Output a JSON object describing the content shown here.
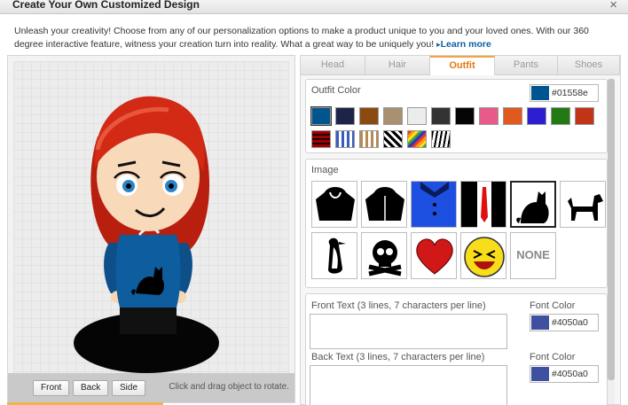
{
  "dialog": {
    "title": "Create Your Own Customized Design",
    "close_icon": "×"
  },
  "intro": {
    "text": "Unleash your creativity! Choose from any of our personalization options to make a product unique to you and your loved ones. With our 360 degree interactive feature, witness your creation turn into reality. What a great way to be uniquely you!",
    "learn_more": "Learn more",
    "arrow": "▸"
  },
  "preview": {
    "buttons": {
      "front": "Front",
      "back": "Back",
      "side": "Side"
    },
    "hint": "Click and drag object to rotate."
  },
  "tabs": [
    {
      "label": "Head"
    },
    {
      "label": "Hair"
    },
    {
      "label": "Outfit",
      "active": true
    },
    {
      "label": "Pants"
    },
    {
      "label": "Shoes"
    }
  ],
  "outfit_color": {
    "label": "Outfit Color",
    "value": "#01558e",
    "swatches": [
      "#01558e",
      "#1d2447",
      "#8a4a12",
      "#a89070",
      "#ececec",
      "#333333",
      "#050505",
      "#e85a8a",
      "#e05a1e",
      "#2b1fcf",
      "#247a12",
      "#c23418"
    ],
    "patterns": [
      "red-plaid",
      "blue-plaid",
      "tan-plaid",
      "houndstooth",
      "rainbow-stripe",
      "zebra"
    ]
  },
  "image": {
    "label": "Image",
    "items": [
      "hoodie-icon",
      "zip-hoodie-icon",
      "shirt-collar-icon",
      "suit-tie-icon",
      "cat-icon",
      "dog-icon",
      "penguin-icon",
      "skull-icon",
      "heart-icon",
      "laughing-face-icon"
    ],
    "none_label": "NONE",
    "selected": "cat-icon"
  },
  "front_text": {
    "label": "Front Text (3 lines, 7 characters per line)",
    "value": "",
    "font_color_label": "Font Color",
    "font_color": "#4050a0"
  },
  "back_text": {
    "label": "Back Text (3 lines, 7 characters per line)",
    "value": "",
    "font_color_label": "Font Color",
    "font_color": "#4050a0"
  },
  "colors": {
    "accent": "#e47911",
    "link": "#0b5fa5",
    "shirt": "#01558e",
    "hair": "#d22a14"
  }
}
